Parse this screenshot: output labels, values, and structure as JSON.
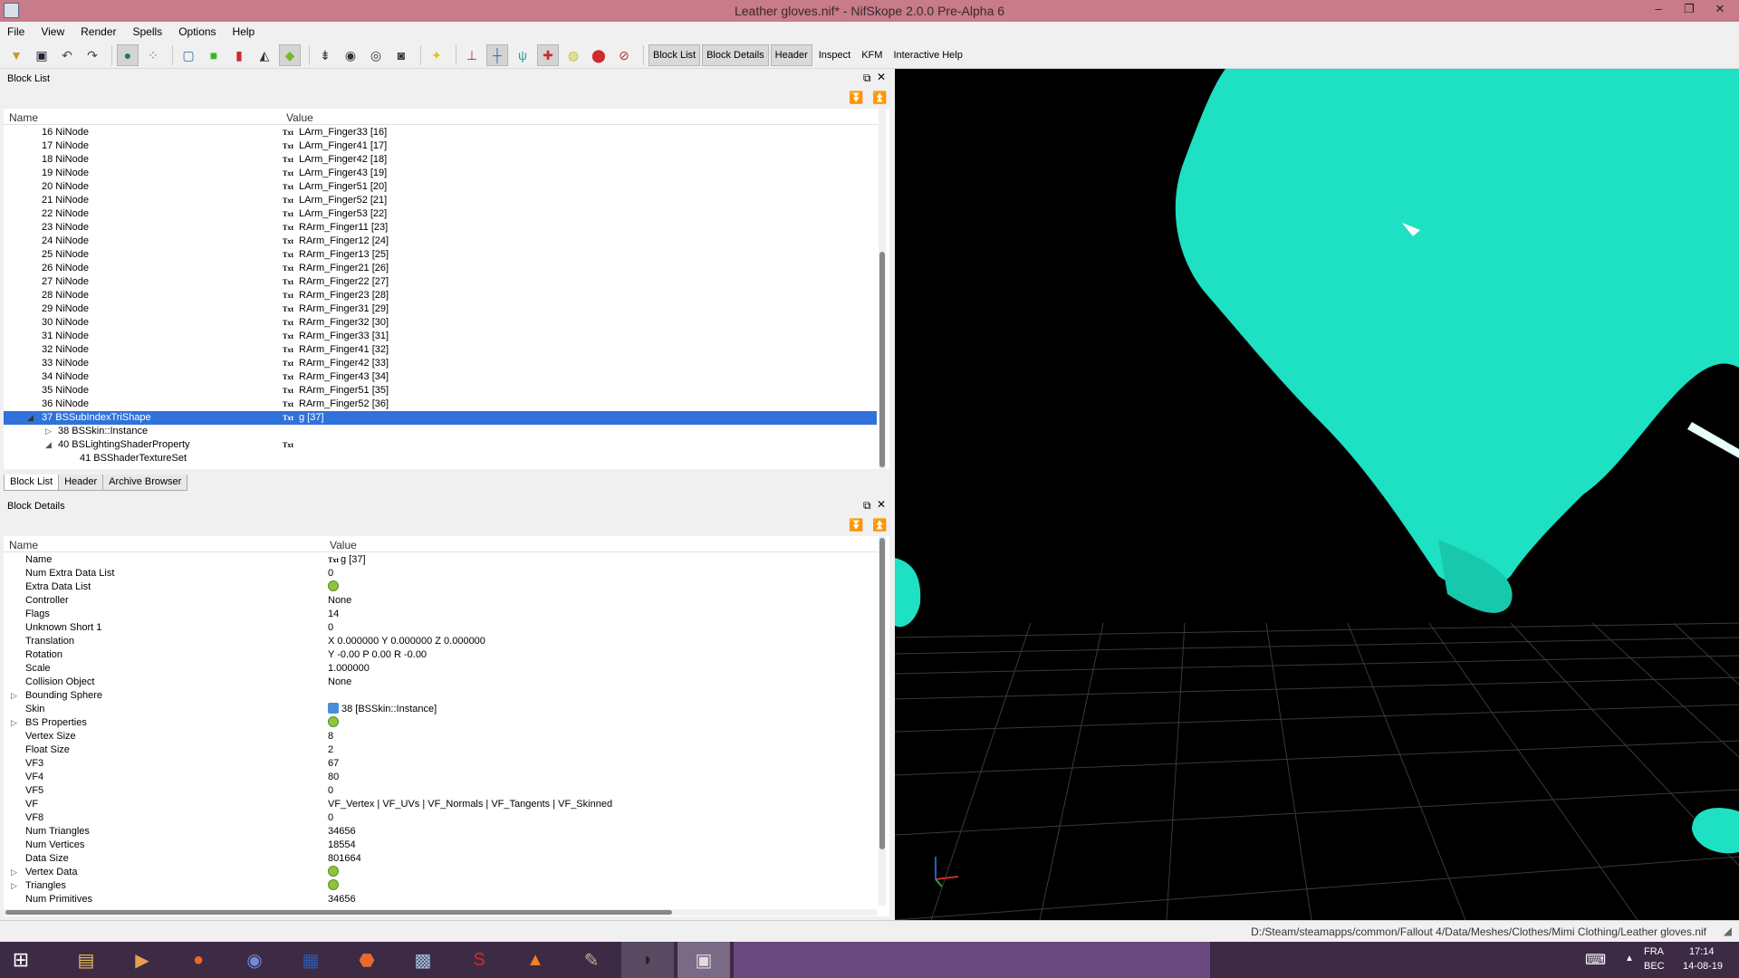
{
  "window": {
    "title": "Leather gloves.nif* - NifSkope 2.0.0 Pre-Alpha 6",
    "minimize": "–",
    "maximize": "❐",
    "close": "✕"
  },
  "menu": [
    "File",
    "View",
    "Render",
    "Spells",
    "Options",
    "Help"
  ],
  "toolbar": {
    "text_buttons": [
      "Block List",
      "Block Details",
      "Header",
      "Inspect",
      "KFM",
      "Interactive Help"
    ]
  },
  "block_list": {
    "title": "Block List",
    "col_name": "Name",
    "col_value": "Value",
    "rows": [
      {
        "name": "16 NiNode",
        "tag": "Txt",
        "value": "LArm_Finger33 [16]"
      },
      {
        "name": "17 NiNode",
        "tag": "Txt",
        "value": "LArm_Finger41 [17]"
      },
      {
        "name": "18 NiNode",
        "tag": "Txt",
        "value": "LArm_Finger42 [18]"
      },
      {
        "name": "19 NiNode",
        "tag": "Txt",
        "value": "LArm_Finger43 [19]"
      },
      {
        "name": "20 NiNode",
        "tag": "Txt",
        "value": "LArm_Finger51 [20]"
      },
      {
        "name": "21 NiNode",
        "tag": "Txt",
        "value": "LArm_Finger52 [21]"
      },
      {
        "name": "22 NiNode",
        "tag": "Txt",
        "value": "LArm_Finger53 [22]"
      },
      {
        "name": "23 NiNode",
        "tag": "Txt",
        "value": "RArm_Finger11 [23]"
      },
      {
        "name": "24 NiNode",
        "tag": "Txt",
        "value": "RArm_Finger12 [24]"
      },
      {
        "name": "25 NiNode",
        "tag": "Txt",
        "value": "RArm_Finger13 [25]"
      },
      {
        "name": "26 NiNode",
        "tag": "Txt",
        "value": "RArm_Finger21 [26]"
      },
      {
        "name": "27 NiNode",
        "tag": "Txt",
        "value": "RArm_Finger22 [27]"
      },
      {
        "name": "28 NiNode",
        "tag": "Txt",
        "value": "RArm_Finger23 [28]"
      },
      {
        "name": "29 NiNode",
        "tag": "Txt",
        "value": "RArm_Finger31 [29]"
      },
      {
        "name": "30 NiNode",
        "tag": "Txt",
        "value": "RArm_Finger32 [30]"
      },
      {
        "name": "31 NiNode",
        "tag": "Txt",
        "value": "RArm_Finger33 [31]"
      },
      {
        "name": "32 NiNode",
        "tag": "Txt",
        "value": "RArm_Finger41 [32]"
      },
      {
        "name": "33 NiNode",
        "tag": "Txt",
        "value": "RArm_Finger42 [33]"
      },
      {
        "name": "34 NiNode",
        "tag": "Txt",
        "value": "RArm_Finger43 [34]"
      },
      {
        "name": "35 NiNode",
        "tag": "Txt",
        "value": "RArm_Finger51 [35]"
      },
      {
        "name": "36 NiNode",
        "tag": "Txt",
        "value": "RArm_Finger52 [36]"
      },
      {
        "name": "37 BSSubIndexTriShape",
        "tag": "Txt",
        "value": "g [37]",
        "selected": true,
        "expander": "◢",
        "indent": 0
      },
      {
        "name": "38 BSSkin::Instance",
        "tag": "",
        "value": "",
        "expander": "▷",
        "indent": 1
      },
      {
        "name": "40 BSLightingShaderProperty",
        "tag": "Txt",
        "value": "",
        "expander": "◢",
        "indent": 1
      },
      {
        "name": "41 BSShaderTextureSet",
        "tag": "",
        "value": "",
        "expander": "",
        "indent": 2
      }
    ]
  },
  "tabs": [
    "Block List",
    "Header",
    "Archive Browser"
  ],
  "block_details": {
    "title": "Block Details",
    "col_name": "Name",
    "col_value": "Value",
    "rows": [
      {
        "name": "Name",
        "value": "g [37]",
        "kind": "txt"
      },
      {
        "name": "Num Extra Data List",
        "value": "0"
      },
      {
        "name": "Extra Data List",
        "value": "",
        "kind": "green"
      },
      {
        "name": "Controller",
        "value": "None"
      },
      {
        "name": "Flags",
        "value": "14"
      },
      {
        "name": "Unknown Short 1",
        "value": "0"
      },
      {
        "name": "Translation",
        "value": "X 0.000000 Y 0.000000 Z 0.000000"
      },
      {
        "name": "Rotation",
        "value": "Y -0.00 P 0.00 R -0.00"
      },
      {
        "name": "Scale",
        "value": "1.000000"
      },
      {
        "name": "Collision Object",
        "value": "None"
      },
      {
        "name": "Bounding Sphere",
        "value": "",
        "expander": "▷"
      },
      {
        "name": "Skin",
        "value": "38 [BSSkin::Instance]",
        "kind": "skin"
      },
      {
        "name": "BS Properties",
        "value": "",
        "kind": "green",
        "expander": "▷"
      },
      {
        "name": "Vertex Size",
        "value": "8"
      },
      {
        "name": "Float Size",
        "value": "2"
      },
      {
        "name": "VF3",
        "value": "67"
      },
      {
        "name": "VF4",
        "value": "80"
      },
      {
        "name": "VF5",
        "value": "0"
      },
      {
        "name": "VF",
        "value": "VF_Vertex | VF_UVs | VF_Normals | VF_Tangents | VF_Skinned"
      },
      {
        "name": "VF8",
        "value": "0"
      },
      {
        "name": "Num Triangles",
        "value": "34656"
      },
      {
        "name": "Num Vertices",
        "value": "18554"
      },
      {
        "name": "Data Size",
        "value": "801664"
      },
      {
        "name": "Vertex Data",
        "value": "",
        "kind": "green",
        "expander": "▷"
      },
      {
        "name": "Triangles",
        "value": "",
        "kind": "green",
        "expander": "▷"
      },
      {
        "name": "Num Primitives",
        "value": "34656"
      }
    ]
  },
  "status": {
    "path": "D:/Steam/steamapps/common/Fallout 4/Data/Meshes/Clothes/Mimi Clothing/Leather gloves.nif"
  },
  "taskbar": {
    "lang1": "FRA",
    "lang2": "BEC",
    "time": "17:14",
    "date": "14-08-19"
  },
  "colors": {
    "mesh": "#1ee0c2",
    "selection": "#3072d9",
    "titlebar": "#c87b88"
  }
}
